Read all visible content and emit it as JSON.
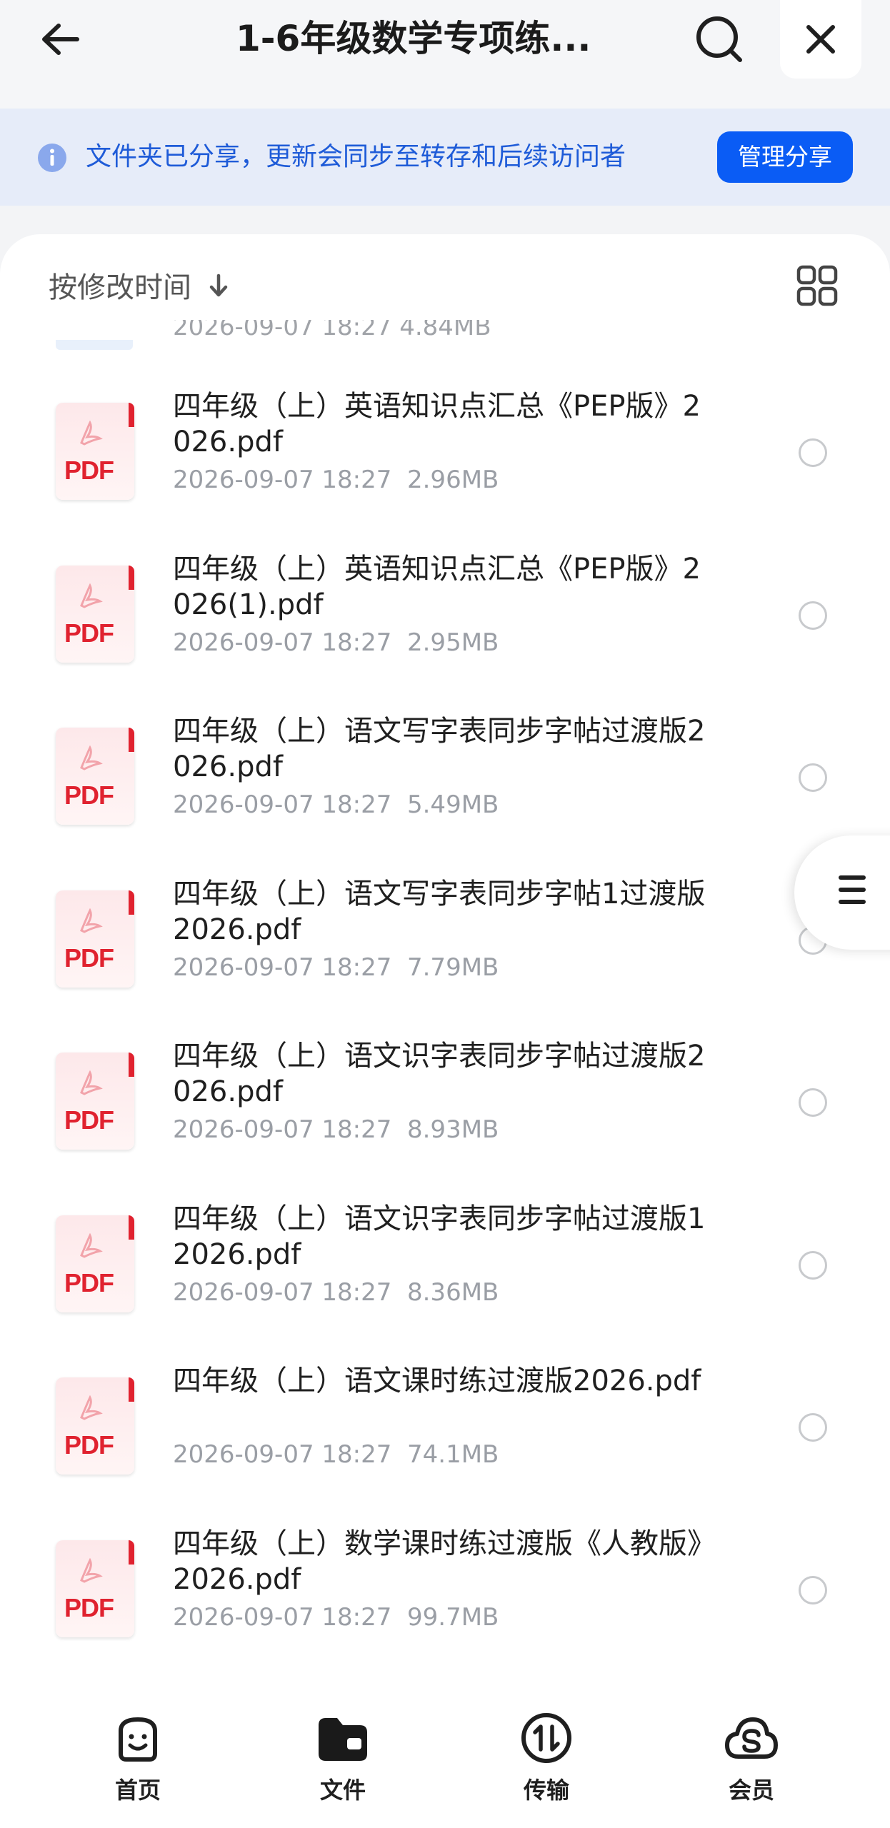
{
  "header": {
    "title": "1-6年级数学专项练...",
    "back_icon": "arrow-left-icon",
    "search_icon": "search-icon",
    "close_icon": "close-icon"
  },
  "banner": {
    "text": "文件夹已分享，更新会同步至转存和后续访问者",
    "button": "管理分享",
    "accent": "#0a5cf5"
  },
  "sort": {
    "label": "按修改时间"
  },
  "partial_row": {
    "meta": "2026-09-07 18:27  4.84MB"
  },
  "files": [
    {
      "name": "四年级（上）英语知识点汇总《PEP版》2026.pdf",
      "meta": "2026-09-07 18:27  2.96MB",
      "thumb": "PDF"
    },
    {
      "name": "四年级（上）英语知识点汇总《PEP版》2026(1).pdf",
      "meta": "2026-09-07 18:27  2.95MB",
      "thumb": "PDF"
    },
    {
      "name": "四年级（上）语文写字表同步字帖过渡版2026.pdf",
      "meta": "2026-09-07 18:27  5.49MB",
      "thumb": "PDF"
    },
    {
      "name": "四年级（上）语文写字表同步字帖1过渡版2026.pdf",
      "meta": "2026-09-07 18:27  7.79MB",
      "thumb": "PDF"
    },
    {
      "name": "四年级（上）语文识字表同步字帖过渡版2026.pdf",
      "meta": "2026-09-07 18:27  8.93MB",
      "thumb": "PDF"
    },
    {
      "name": "四年级（上）语文识字表同步字帖过渡版12026.pdf",
      "meta": "2026-09-07 18:27  8.36MB",
      "thumb": "PDF"
    },
    {
      "name": "四年级（上）语文课时练过渡版2026.pdf",
      "meta": "2026-09-07 18:27  74.1MB",
      "thumb": "PDF"
    },
    {
      "name": "四年级（上）数学课时练过渡版《人教版》2026.pdf",
      "meta": "2026-09-07 18:27  99.7MB",
      "thumb": "PDF"
    }
  ],
  "nav": [
    {
      "label": "首页",
      "icon": "smiley-home-icon"
    },
    {
      "label": "文件",
      "icon": "folder-icon"
    },
    {
      "label": "传输",
      "icon": "transfer-icon"
    },
    {
      "label": "会员",
      "icon": "cloud-member-icon"
    }
  ]
}
